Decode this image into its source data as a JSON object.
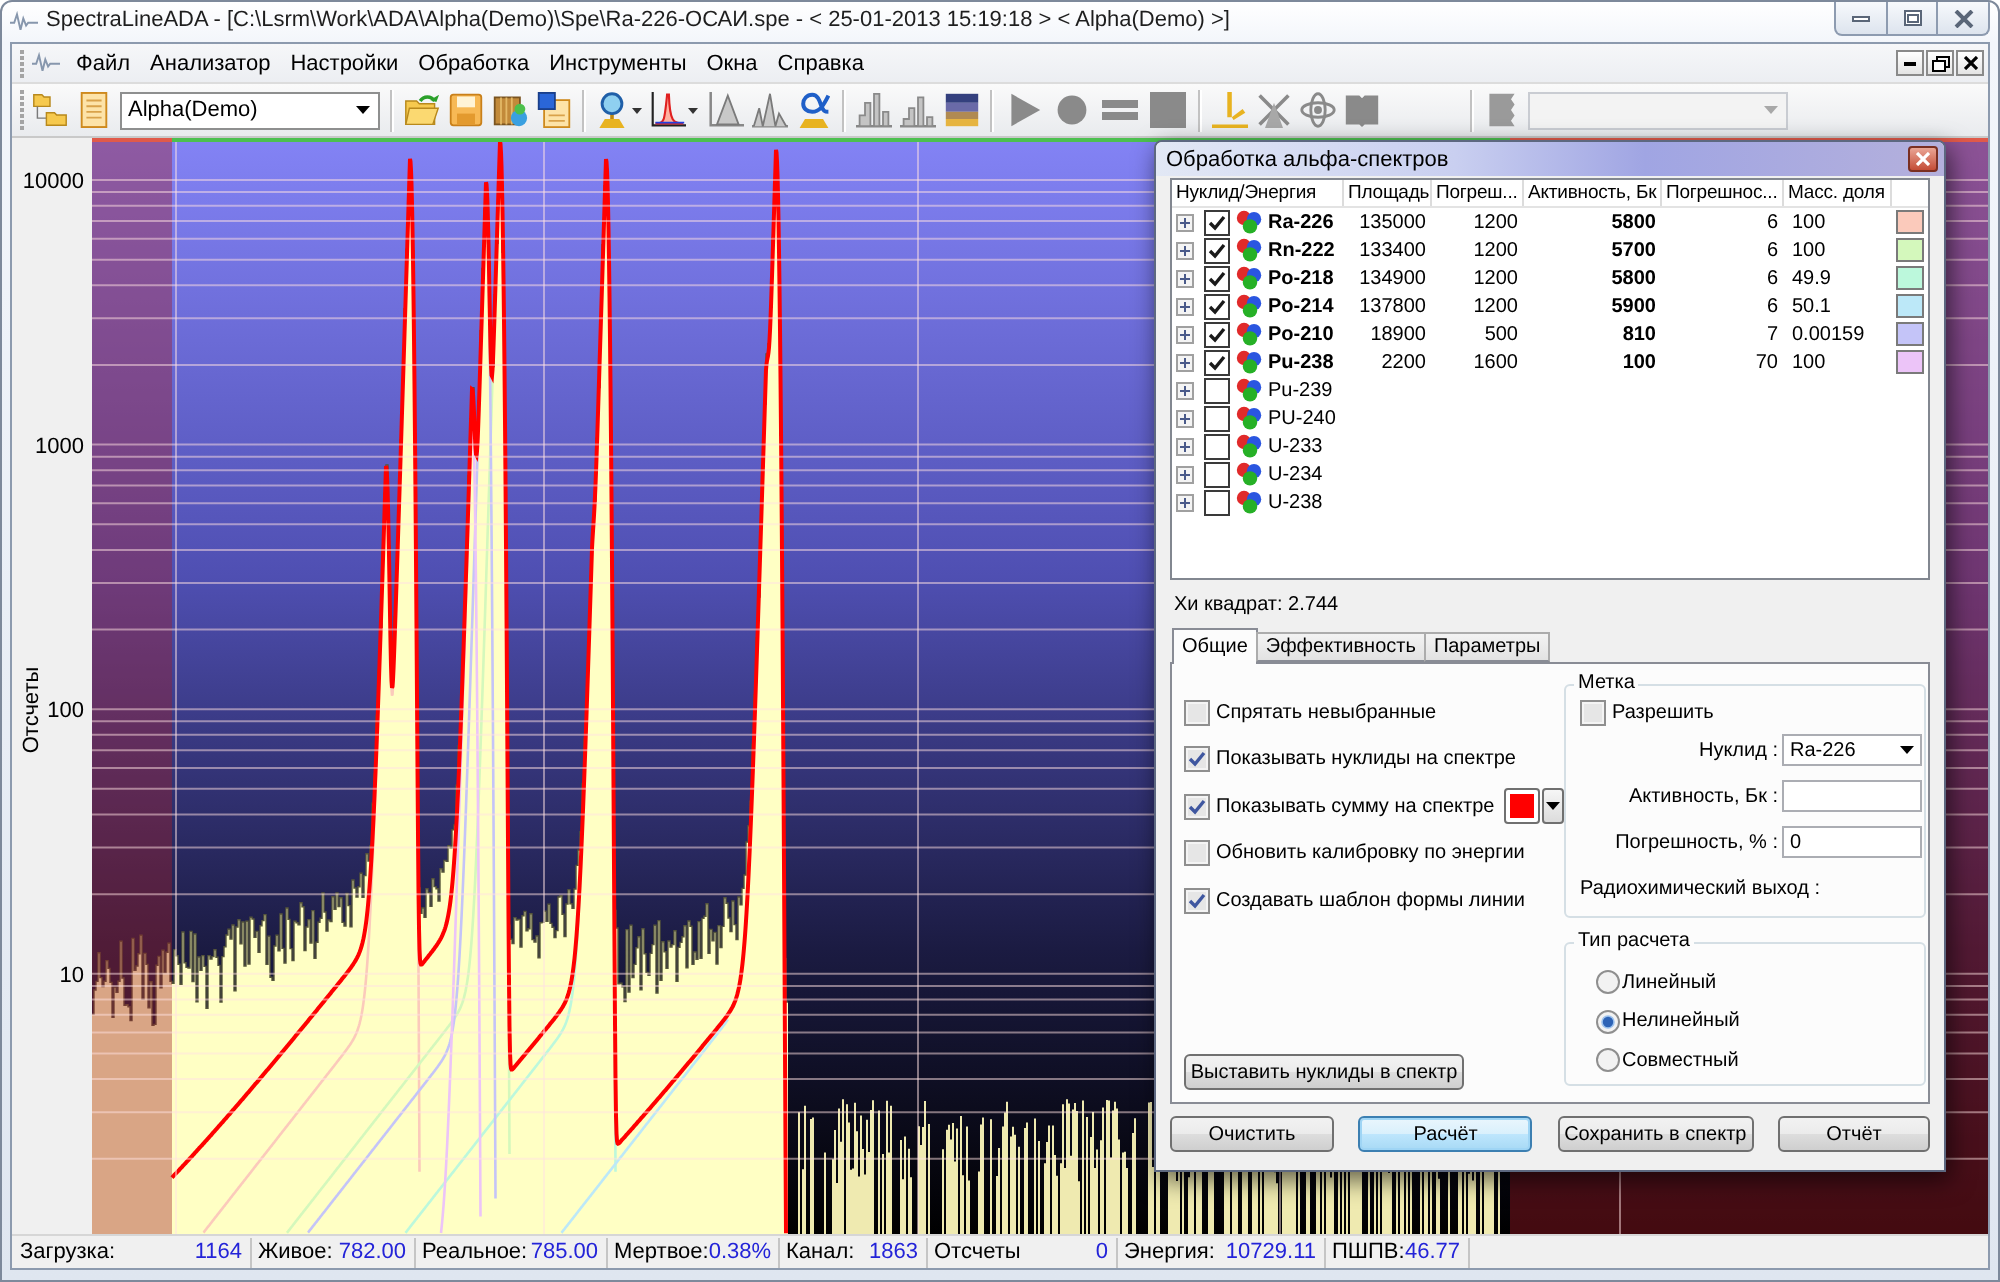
{
  "window": {
    "title": "SpectraLineADA - [C:\\Lsrm\\Work\\ADA\\Alpha(Demo)\\Spe\\Ra-226-ОСАИ.spe - < 25-01-2013 15:19:18 > < Alpha(Demo) >]"
  },
  "menu": [
    "Файл",
    "Анализатор",
    "Настройки",
    "Обработка",
    "Инструменты",
    "Окна",
    "Справка"
  ],
  "toolbar": {
    "detector": "Alpha(Demo)",
    "second_combo": {
      "disabled": true
    }
  },
  "chart": {
    "y_axis_title": "Отсчеты",
    "y_ticks": [
      "10000",
      "1000",
      "100",
      "10"
    ]
  },
  "dialog": {
    "title": "Обработка альфа-спектров",
    "columns": [
      "Нуклид/Энергия",
      "Площадь",
      "Погреш...",
      "Активность, Бк",
      "Погрешнос...",
      "Масс. доля"
    ],
    "rows": [
      {
        "nuclide": "Ra-226",
        "expanded": false,
        "checked": true,
        "area": "135000",
        "area_error": "1200",
        "activity": "5800",
        "activity_error": "6",
        "mass_fraction": "100",
        "color": "#fbcabb"
      },
      {
        "nuclide": "Rn-222",
        "expanded": false,
        "checked": true,
        "area": "133400",
        "area_error": "1200",
        "activity": "5700",
        "activity_error": "6",
        "mass_fraction": "100",
        "color": "#d4f8bc"
      },
      {
        "nuclide": "Po-218",
        "expanded": false,
        "checked": true,
        "area": "134900",
        "area_error": "1200",
        "activity": "5800",
        "activity_error": "6",
        "mass_fraction": "49.9",
        "color": "#bcf8dc"
      },
      {
        "nuclide": "Po-214",
        "expanded": false,
        "checked": true,
        "area": "137800",
        "area_error": "1200",
        "activity": "5900",
        "activity_error": "6",
        "mass_fraction": "50.1",
        "color": "#bce8f8"
      },
      {
        "nuclide": "Po-210",
        "expanded": false,
        "checked": true,
        "area": "18900",
        "area_error": "500",
        "activity": "810",
        "activity_error": "7",
        "mass_fraction": "0.00159",
        "color": "#c4c4f8"
      },
      {
        "nuclide": "Pu-238",
        "expanded": false,
        "checked": true,
        "area": "2200",
        "area_error": "1600",
        "activity": "100",
        "activity_error": "70",
        "mass_fraction": "100",
        "color": "#ecc4f8"
      },
      {
        "nuclide": "Pu-239",
        "expanded": false,
        "checked": false
      },
      {
        "nuclide": "PU-240",
        "expanded": false,
        "checked": false
      },
      {
        "nuclide": "U-233",
        "expanded": false,
        "checked": false
      },
      {
        "nuclide": "U-234",
        "expanded": false,
        "checked": false
      },
      {
        "nuclide": "U-238",
        "expanded": false,
        "checked": false
      }
    ],
    "chi_square": "Хи квадрат: 2.744",
    "tabs": [
      {
        "label": "Общие",
        "selected": true
      },
      {
        "label": "Эффективность",
        "selected": false
      },
      {
        "label": "Параметры",
        "selected": false
      }
    ],
    "options": [
      {
        "label": "Спрятать невыбранные",
        "checked": false
      },
      {
        "label": "Показывать нуклиды на спектре",
        "checked": true
      },
      {
        "label": "Показывать сумму на спектре",
        "checked": true,
        "color": "#ff0000"
      },
      {
        "label": "Обновить калибровку по энергии",
        "checked": false
      },
      {
        "label": "Создавать шаблон формы линии",
        "checked": true
      }
    ],
    "place_button": "Выставить нуклиды в спектр",
    "mark": {
      "title": "Метка",
      "enable": {
        "label": "Разрешить",
        "checked": false
      },
      "fields": [
        {
          "kind": "combo",
          "label": "Нуклид :",
          "value": "Ra-226"
        },
        {
          "kind": "input",
          "label": "Активность, Бк :"
        },
        {
          "kind": "input",
          "label": "Погрешность, % :",
          "value": "0"
        },
        {
          "kind": "text",
          "label": "Радиохимический выход :"
        }
      ]
    },
    "calc_type": {
      "title": "Тип расчета",
      "options": [
        {
          "label": "Линейный",
          "selected": false
        },
        {
          "label": "Нелинейный",
          "selected": true
        },
        {
          "label": "Совместный",
          "selected": false
        }
      ]
    },
    "buttons": [
      {
        "label": "Очистить",
        "default": false
      },
      {
        "label": "Расчёт",
        "default": true
      },
      {
        "label": "Сохранить в спектр",
        "default": false
      },
      {
        "label": "Отчёт",
        "default": false
      }
    ]
  },
  "status_bar": [
    {
      "label": "Загрузка:",
      "value": "1164"
    },
    {
      "label": "Живое:",
      "value": "782.00"
    },
    {
      "label": "Реальное:",
      "value": "785.00"
    },
    {
      "label": "Мертвое:",
      "value": "0.38%"
    },
    {
      "label": "Канал:",
      "value": "1863"
    },
    {
      "label": "Отсчеты",
      "value": "0"
    },
    {
      "label": "Энергия:",
      "value": "10729.11"
    },
    {
      "label": "ПШПВ:",
      "value": "46.77"
    }
  ]
}
